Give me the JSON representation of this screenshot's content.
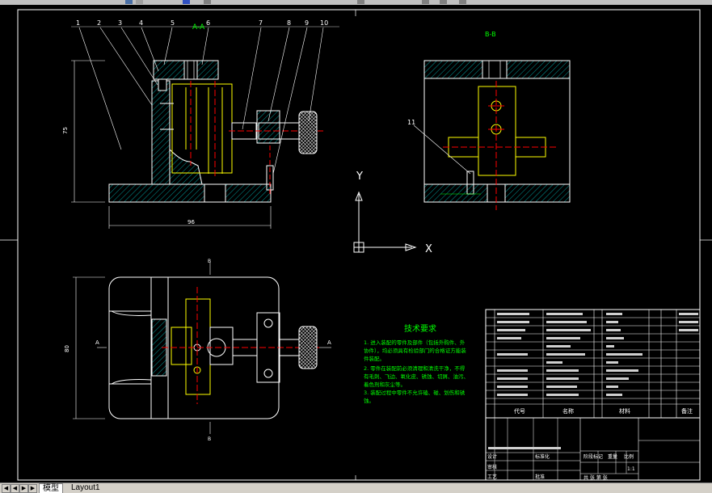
{
  "drawing": {
    "section_bb_label": "B-B",
    "section_aa_label": "A-A",
    "dim_height": "75",
    "dim_width": "96",
    "dim_side": "80",
    "section_mark_a": "A",
    "section_mark_b": "B",
    "balloon_11": "11",
    "balloons": [
      "1",
      "2",
      "3",
      "4",
      "5",
      "6",
      "7",
      "8",
      "9",
      "10"
    ],
    "ucs_y": "Y",
    "ucs_x": "X",
    "tech_title": "技术要求",
    "tech_lines": [
      "1. 进入装配的零件及部件（包括外购件、外",
      "协件），均必须具有检验部门的合格证方能装",
      "件装配。",
      "2. 零件在装配前必须清理和清洗干净，不得",
      "有毛刺、飞边、氧化皮、锈蚀、切屑、油污、",
      "着色剂和灰尘等。",
      "3. 装配过程中零件不允许磕、碰、划伤和锈",
      "蚀。"
    ],
    "title_block": {
      "col_code": "代号",
      "col_name": "名称",
      "col_material": "材料",
      "col_remark": "备注",
      "scale": "1:1",
      "drawn": "设计",
      "check": "审核",
      "process": "工艺",
      "standard": "标准化",
      "approve": "批准",
      "stage_mark": "阶段标记",
      "weight": "重量",
      "ratio": "比例",
      "sheets": "共 张 第 张"
    }
  },
  "tabs": {
    "model": "模型",
    "layout1": "Layout1"
  },
  "colors": {
    "background": "#000000",
    "outline": "#ffffff",
    "hatch": "#00c0c0",
    "part": "#ffff00",
    "centerline": "#ff0000",
    "text_green": "#00ff00"
  }
}
